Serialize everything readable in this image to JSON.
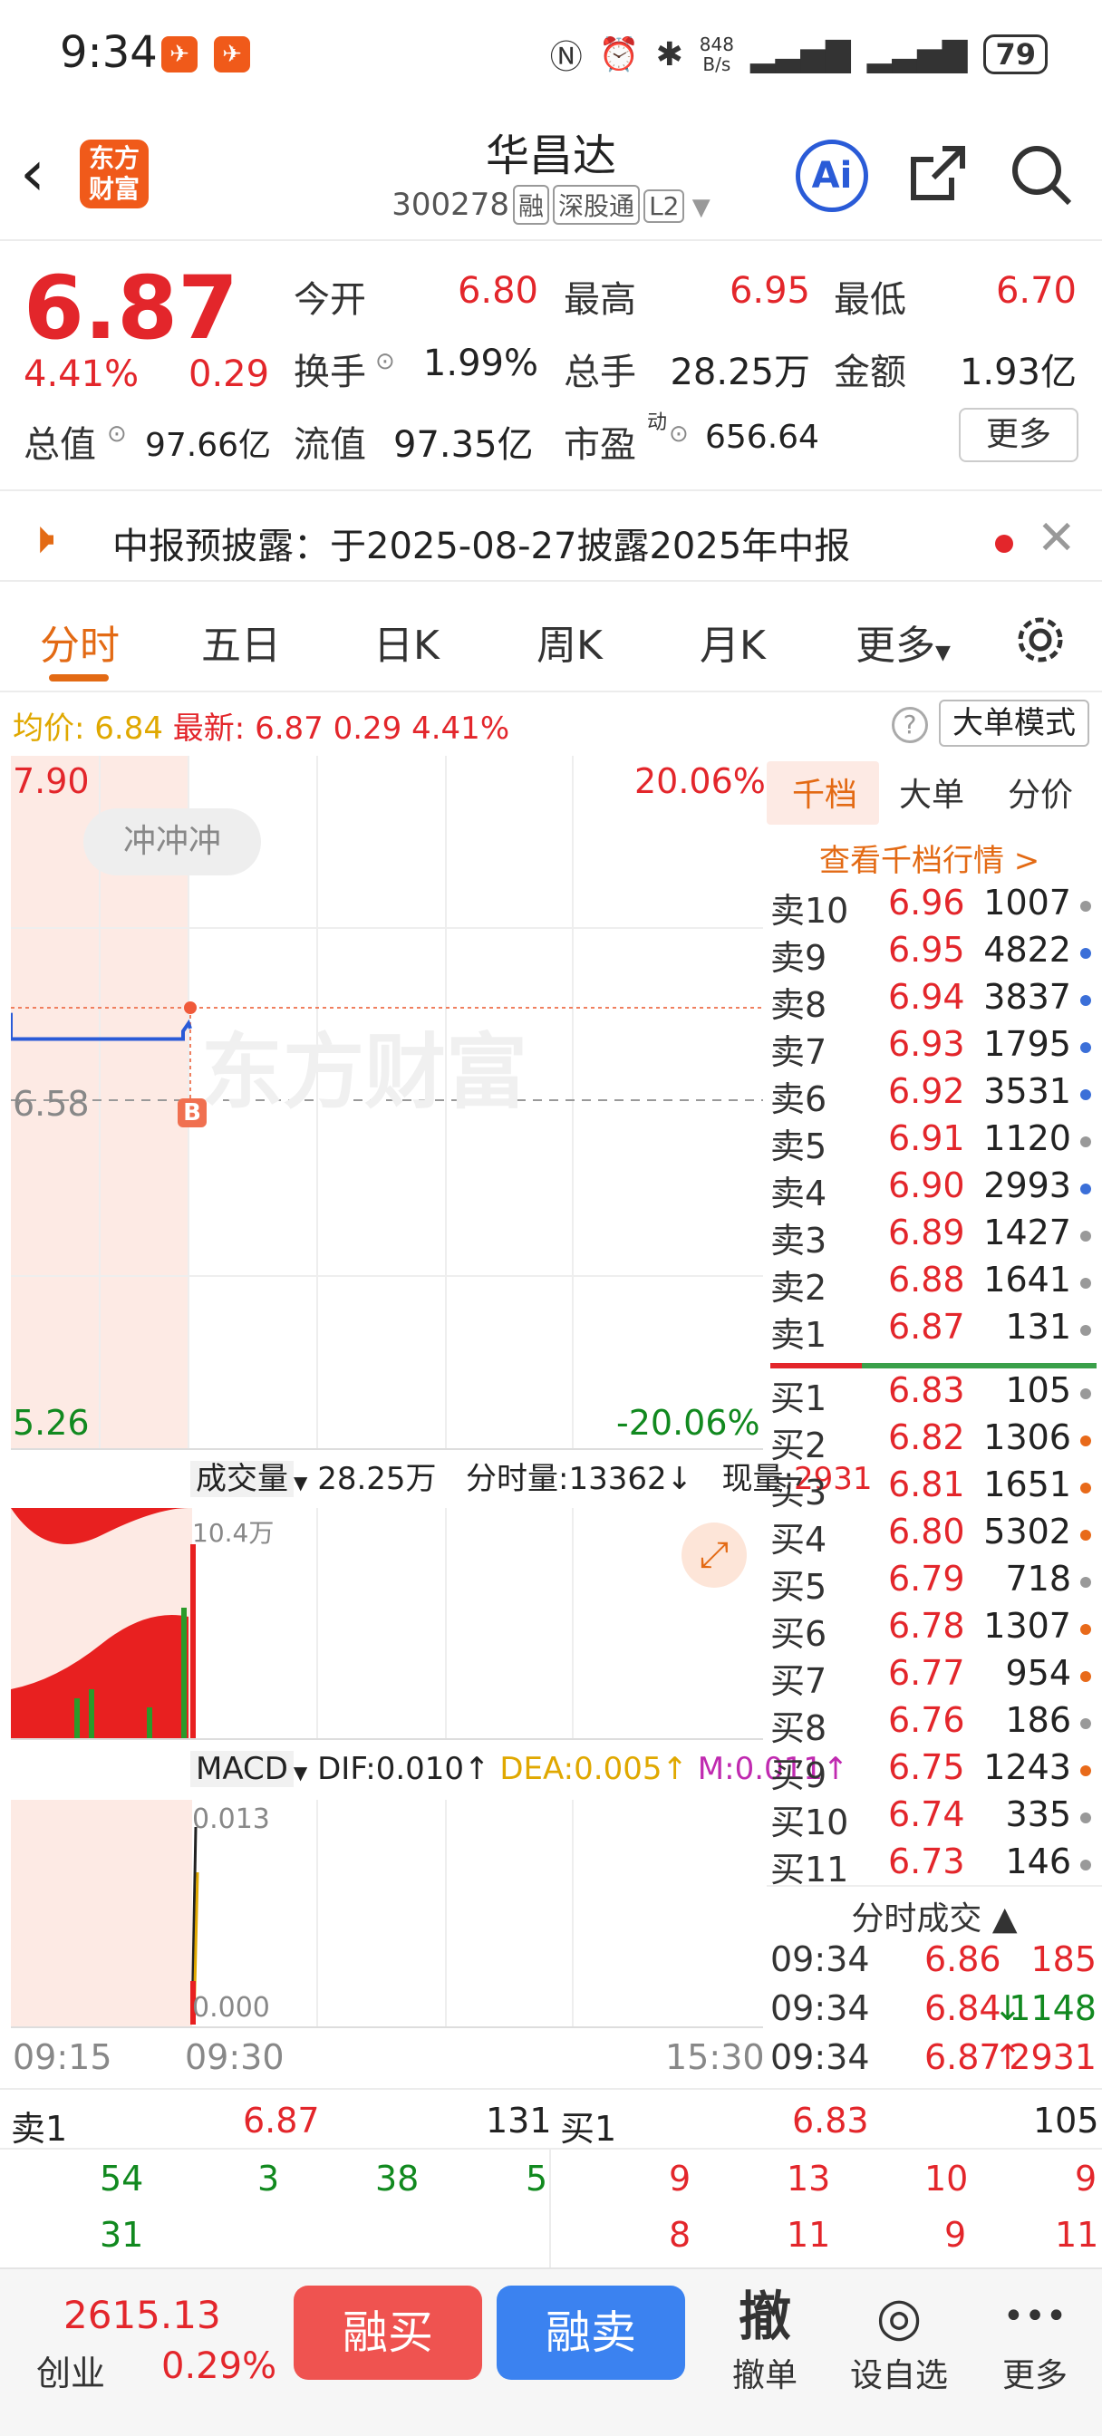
{
  "status": {
    "time": "9:34",
    "net_speed": "848\nB/s",
    "battery": "79"
  },
  "header": {
    "name": "华昌达",
    "code": "300278",
    "tags": [
      "融",
      "深股通",
      "L2"
    ],
    "logo": "东方\n财富",
    "ai": "Ai"
  },
  "quote": {
    "price": "6.87",
    "pct": "4.41%",
    "change": "0.29",
    "open_label": "今开",
    "open": "6.80",
    "high_label": "最高",
    "high": "6.95",
    "low_label": "最低",
    "low": "6.70",
    "turnover_label": "换手",
    "turnover": "1.99%",
    "volume_label": "总手",
    "volume": "28.25万",
    "amount_label": "金额",
    "amount": "1.93亿",
    "mktcap_label": "总值",
    "mktcap": "97.66亿",
    "float_label": "流值",
    "float": "97.35亿",
    "pe_label": "市盈",
    "pe_sup": "动",
    "pe": "656.64",
    "more": "更多"
  },
  "notice": {
    "text": "中报预披露：于2025-08-27披露2025年中报"
  },
  "tabs": [
    "分时",
    "五日",
    "日K",
    "周K",
    "月K",
    "更多"
  ],
  "avgline": {
    "avg_label": "均价:",
    "avg": "6.84",
    "latest_label": "最新:",
    "latest": "6.87",
    "chg": "0.29",
    "pct": "4.41%",
    "mode": "大单模式"
  },
  "chart": {
    "top": "7.90",
    "mid": "6.58",
    "bottom": "5.26",
    "top_pct": "20.06%",
    "bottom_pct": "-20.06%",
    "bubble": "冲冲冲",
    "marker": "B",
    "watermark": "东方财富",
    "t0": "09:15",
    "t1": "09:30",
    "t2": "15:30"
  },
  "chart_data": {
    "type": "line",
    "x": [
      "09:15",
      "09:30",
      "15:30"
    ],
    "ylim": [
      5.26,
      7.9
    ],
    "prev_close": 6.58,
    "series": [
      {
        "values": [
          6.82,
          6.82,
          6.88
        ]
      }
    ]
  },
  "volume": {
    "label": "成交量",
    "total": "28.25万",
    "minute": "分时量:13362",
    "now_label": "现量:",
    "now": "2931",
    "scale": "10.4万"
  },
  "macd": {
    "label": "MACD",
    "dif": "DIF:0.010",
    "dea": "DEA:0.005",
    "m": "M:0.011",
    "top": "0.013",
    "bottom": "0.000"
  },
  "orderbook": {
    "tabs": [
      "千档",
      "大单",
      "分价"
    ],
    "link": "查看千档行情 >",
    "asks": [
      {
        "l": "卖10",
        "p": "6.96",
        "v": "1007",
        "c": "#999"
      },
      {
        "l": "卖9",
        "p": "6.95",
        "v": "4822",
        "c": "#3b6fd8"
      },
      {
        "l": "卖8",
        "p": "6.94",
        "v": "3837",
        "c": "#3b6fd8"
      },
      {
        "l": "卖7",
        "p": "6.93",
        "v": "1795",
        "c": "#3b6fd8"
      },
      {
        "l": "卖6",
        "p": "6.92",
        "v": "3531",
        "c": "#3b6fd8"
      },
      {
        "l": "卖5",
        "p": "6.91",
        "v": "1120",
        "c": "#999"
      },
      {
        "l": "卖4",
        "p": "6.90",
        "v": "2993",
        "c": "#3b6fd8"
      },
      {
        "l": "卖3",
        "p": "6.89",
        "v": "1427",
        "c": "#999"
      },
      {
        "l": "卖2",
        "p": "6.88",
        "v": "1641",
        "c": "#999"
      },
      {
        "l": "卖1",
        "p": "6.87",
        "v": "131",
        "c": "#999"
      }
    ],
    "bids": [
      {
        "l": "买1",
        "p": "6.83",
        "v": "105",
        "c": "#999"
      },
      {
        "l": "买2",
        "p": "6.82",
        "v": "1306",
        "c": "#e86a1a"
      },
      {
        "l": "买3",
        "p": "6.81",
        "v": "1651",
        "c": "#e86a1a"
      },
      {
        "l": "买4",
        "p": "6.80",
        "v": "5302",
        "c": "#e86a1a"
      },
      {
        "l": "买5",
        "p": "6.79",
        "v": "718",
        "c": "#999"
      },
      {
        "l": "买6",
        "p": "6.78",
        "v": "1307",
        "c": "#e86a1a"
      },
      {
        "l": "买7",
        "p": "6.77",
        "v": "954",
        "c": "#e86a1a"
      },
      {
        "l": "买8",
        "p": "6.76",
        "v": "186",
        "c": "#999"
      },
      {
        "l": "买9",
        "p": "6.75",
        "v": "1243",
        "c": "#e86a1a"
      },
      {
        "l": "买10",
        "p": "6.74",
        "v": "335",
        "c": "#999"
      },
      {
        "l": "买11",
        "p": "6.73",
        "v": "146",
        "c": "#999"
      }
    ],
    "trades_title": "分时成交",
    "trades": [
      {
        "t": "09:34",
        "p": "6.86",
        "v": "185",
        "pc": "#e3262b",
        "vc": "#e3262b",
        "a": ""
      },
      {
        "t": "09:34",
        "p": "6.84",
        "v": "1148",
        "pc": "#e3262b",
        "vc": "#11891f",
        "a": "↓"
      },
      {
        "t": "09:34",
        "p": "6.87",
        "v": "2931",
        "pc": "#e3262b",
        "vc": "#e3262b",
        "a": "↑"
      }
    ]
  },
  "depth": {
    "ask_label": "卖1",
    "ask_p": "6.87",
    "ask_v": "131",
    "bid_label": "买1",
    "bid_p": "6.83",
    "bid_v": "105",
    "ask_q1": [
      "54",
      "3",
      "38",
      "5"
    ],
    "ask_q2": [
      "31"
    ],
    "bid_q1": [
      "9",
      "13",
      "10",
      "9"
    ],
    "bid_q2": [
      "8",
      "11",
      "9",
      "11"
    ]
  },
  "nav": {
    "index_val": "2615.13",
    "index_name": "创业",
    "index_pct": "0.29%",
    "buy": "融买",
    "sell": "融卖",
    "items": [
      {
        "ic": "撤",
        "lb": "撤单"
      },
      {
        "ic": "◎",
        "lb": "设自选"
      },
      {
        "ic": "•••",
        "lb": "更多"
      }
    ]
  }
}
